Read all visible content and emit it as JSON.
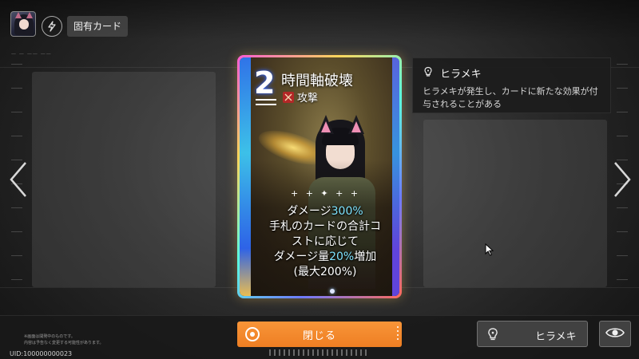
{
  "header": {
    "avatar_icon": "character-portrait",
    "skill_icon": "lightning-icon",
    "tag_label": "固有カード"
  },
  "card": {
    "cost": "2",
    "name": "時間軸破壊",
    "type_icon": "attack-icon",
    "type_label": "攻撃",
    "description_lines": [
      [
        "ダメージ",
        "300%",
        ""
      ],
      [
        "手札のカードの合計コ",
        "",
        ""
      ],
      [
        "ストに応じて",
        "",
        ""
      ],
      [
        "ダメージ量",
        "20%",
        "増加"
      ],
      [
        "(最大200%)",
        "",
        ""
      ]
    ],
    "border_colors": [
      "#ff5bd6",
      "#ffd65b",
      "#5bffe0",
      "#6d7bff",
      "#ff6a5b"
    ],
    "highlight_color": "#7fe4ff"
  },
  "tooltip": {
    "icon": "lightbulb-icon",
    "title": "ヒラメキ",
    "body": "ヒラメキが発生し、カードに新たな効果が付与されることがある"
  },
  "navigation": {
    "prev_icon": "chevron-left-icon",
    "next_icon": "chevron-right-icon"
  },
  "footer": {
    "notes": [
      "※画面は開発中のものです。",
      "内容は予告なく変更する可能性があります。"
    ],
    "uid": "UID:100000000023",
    "close_label": "閉じる",
    "close_color": "#f08326",
    "hirameki_label": "ヒラメキ",
    "eye_icon": "eye-icon"
  }
}
